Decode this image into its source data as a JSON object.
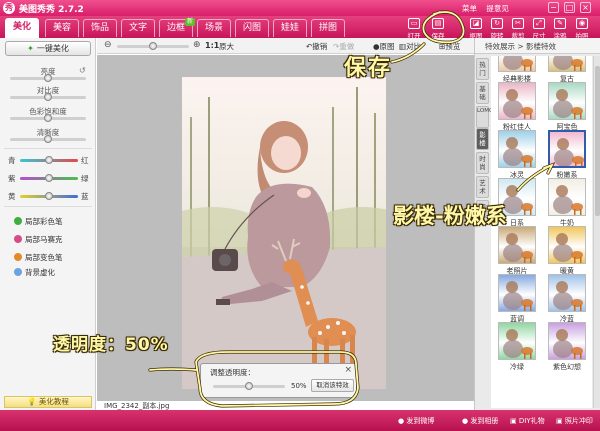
{
  "window": {
    "title": "美图秀秀 2.7.2",
    "logo_glyph": "秀",
    "links": [
      "菜单",
      "提意见"
    ],
    "controls": [
      "−",
      "□",
      "×"
    ]
  },
  "tabs": [
    {
      "label": "美化",
      "active": true
    },
    {
      "label": "美容",
      "active": false
    },
    {
      "label": "饰品",
      "active": false
    },
    {
      "label": "文字",
      "active": false
    },
    {
      "label": "边框",
      "active": false,
      "badge": "新"
    },
    {
      "label": "场景",
      "active": false
    },
    {
      "label": "闪图",
      "active": false
    },
    {
      "label": "娃娃",
      "active": false
    },
    {
      "label": "拼图",
      "active": false
    }
  ],
  "toolbar": [
    {
      "label": "打开",
      "icon": "folder-icon"
    },
    {
      "label": "保存",
      "icon": "save-icon"
    },
    {
      "label": "抠图",
      "icon": "cutout-icon"
    },
    {
      "label": "旋转",
      "icon": "rotate-icon"
    },
    {
      "label": "裁剪",
      "icon": "crop-icon"
    },
    {
      "label": "尺寸",
      "icon": "resize-icon"
    },
    {
      "label": "涂鸦",
      "icon": "brush-icon"
    },
    {
      "label": "拍照",
      "icon": "camera-icon"
    }
  ],
  "left": {
    "one_key": "一键美化",
    "adjust": [
      {
        "label": "亮度",
        "value": 0.5
      },
      {
        "label": "对比度",
        "value": 0.5
      },
      {
        "label": "色彩饱和度",
        "value": 0.5
      },
      {
        "label": "清晰度",
        "value": 0.5
      }
    ],
    "color_sliders": [
      {
        "left": "青",
        "right": "红",
        "value": 0.5,
        "gradient": [
          "#33c9d6",
          "#e54848"
        ]
      },
      {
        "left": "紫",
        "right": "绿",
        "value": 0.5,
        "gradient": [
          "#b04fd0",
          "#4fbf4a"
        ]
      },
      {
        "left": "黄",
        "right": "蓝",
        "value": 0.5,
        "gradient": [
          "#e3cf2c",
          "#3d6ddb"
        ]
      }
    ],
    "tools": [
      {
        "label": "局部彩色笔",
        "color": "#3fae3f"
      },
      {
        "label": "局部马赛克",
        "color": "#d84b8a"
      },
      {
        "label": "局部变色笔",
        "color": "#e28a2a"
      },
      {
        "label": "背景虚化",
        "color": "#6aa3e0"
      }
    ],
    "tutorial": "美化教程"
  },
  "topbar": {
    "ratio": "1:1",
    "original": "原大",
    "undo": "撤销",
    "redo": "重做",
    "original_image": "原图",
    "compare": "对比",
    "preview": "预览",
    "zoom_value": 0.5
  },
  "canvas": {
    "filename": "IMG_2342_副本.jpg",
    "transparency": {
      "title": "调整透明度：",
      "value": "50%",
      "fraction": 0.5,
      "cancel": "取消该特效",
      "close": "×"
    }
  },
  "right": {
    "breadcrumb": "特效展示 > 影楼特效",
    "categories": [
      {
        "label": "热门",
        "active": false
      },
      {
        "label": "基础",
        "active": false
      },
      {
        "label": "LOMO",
        "active": false
      },
      {
        "label": "影楼",
        "active": true
      },
      {
        "label": "时尚",
        "active": false
      },
      {
        "label": "艺术",
        "active": false
      },
      {
        "label": "调色",
        "active": false
      }
    ],
    "effects": [
      {
        "label": "经典影楼",
        "tint": "#e8c9a8"
      },
      {
        "label": "复古",
        "tint": "#d8c07a"
      },
      {
        "label": "粉红佳人",
        "tint": "#eab6c8"
      },
      {
        "label": "阿宝色",
        "tint": "#a9d9c4"
      },
      {
        "label": "冰灵",
        "tint": "#9dd0e8"
      },
      {
        "label": "粉嫩系",
        "tint": "#f2b9cf",
        "selected": true
      },
      {
        "label": "日系",
        "tint": "#cfe8f2"
      },
      {
        "label": "牛奶",
        "tint": "#f1eee4"
      },
      {
        "label": "老照片",
        "tint": "#c9a978"
      },
      {
        "label": "暖黄",
        "tint": "#f1c65c"
      },
      {
        "label": "蓝调",
        "tint": "#86a9e0"
      },
      {
        "label": "冷蓝",
        "tint": "#9fc2e8"
      },
      {
        "label": "冷绿",
        "tint": "#92d6a2"
      },
      {
        "label": "紫色幻想",
        "tint": "#c8a0e0"
      }
    ]
  },
  "status": {
    "items": [
      "发到微博",
      "发到相册",
      "DIY礼物",
      "照片冲印"
    ]
  },
  "annotations": {
    "save": "保存",
    "studio": "影楼-粉嫩系",
    "opacity": "透明度：50%"
  }
}
